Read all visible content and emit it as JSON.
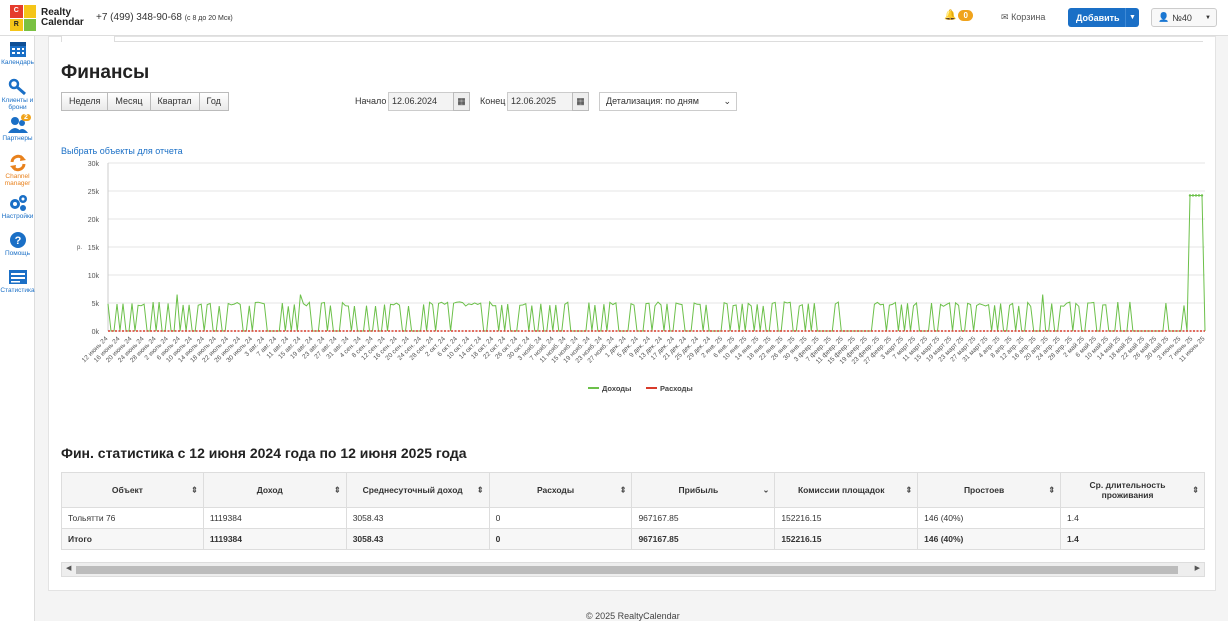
{
  "header": {
    "logo_letters": [
      "C",
      "R",
      "",
      ""
    ],
    "logo_line1": "Realty",
    "logo_line2": "Calendar",
    "phone": "+7 (499) 348-90-68",
    "phone_hours": "(с 8 до 20 Мск)",
    "notif_count": "0",
    "cart_label": "Корзина",
    "add_label": "Добавить",
    "user_label": "№40"
  },
  "sidebar": {
    "items": [
      {
        "label": "Календарь",
        "icon": "calendar-icon"
      },
      {
        "label": "Клиенты и брони",
        "icon": "key-icon"
      },
      {
        "label": "Партнеры",
        "icon": "users-icon",
        "badge": "2"
      },
      {
        "label": "Channel manager",
        "icon": "sync-icon"
      },
      {
        "label": "Настройки",
        "icon": "gears-icon"
      },
      {
        "label": "Помощь",
        "icon": "help-icon"
      },
      {
        "label": "Статистика",
        "icon": "stats-icon"
      }
    ]
  },
  "page": {
    "title": "Финансы",
    "periods": [
      "Неделя",
      "Месяц",
      "Квартал",
      "Год"
    ],
    "start_label": "Начало",
    "start_value": "12.06.2024",
    "end_label": "Конец",
    "end_value": "12.06.2025",
    "detail_select": "Детализация: по дням",
    "objects_link": "Выбрать объекты для отчета"
  },
  "chart_data": {
    "type": "line",
    "ylim": [
      0,
      30000
    ],
    "y_ticks": [
      "0k",
      "5k",
      "10k",
      "15k",
      "20k",
      "25k",
      "30k"
    ],
    "ylabel": "р.",
    "x_ticks": [
      "12 июнь 24",
      "16 июнь 24",
      "20 июнь 24",
      "24 июнь 24",
      "28 июнь 24",
      "2 июль 24",
      "6 июль 24",
      "10 июль 24",
      "14 июль 24",
      "18 июль 24",
      "22 июль 24",
      "26 июль 24",
      "30 июль 24",
      "3 авг. 24",
      "7 авг. 24",
      "11 авг. 24",
      "15 авг. 24",
      "19 авг. 24",
      "23 авг. 24",
      "27 авг. 24",
      "31 авг. 24",
      "4 сен. 24",
      "8 сен. 24",
      "12 сен. 24",
      "16 сен. 24",
      "20 сен. 24",
      "24 сен. 24",
      "28 сен. 24",
      "2 окт. 24",
      "6 окт. 24",
      "10 окт. 24",
      "14 окт. 24",
      "18 окт. 24",
      "22 окт. 24",
      "26 окт. 24",
      "30 окт. 24",
      "3 нояб. 24",
      "7 нояб. 24",
      "11 нояб. 24",
      "15 нояб. 24",
      "19 нояб. 24",
      "23 нояб. 24",
      "27 нояб. 24",
      "1 дек. 24",
      "5 дек. 24",
      "9 дек. 24",
      "13 дек. 24",
      "17 дек. 24",
      "21 дек. 24",
      "25 дек. 24",
      "29 дек. 24",
      "2 янв. 25",
      "6 янв. 25",
      "10 янв. 25",
      "14 янв. 25",
      "18 янв. 25",
      "22 янв. 25",
      "26 янв. 25",
      "30 янв. 25",
      "3 февр. 25",
      "7 февр. 25",
      "11 февр. 25",
      "15 февр. 25",
      "19 февр. 25",
      "23 февр. 25",
      "27 февр. 25",
      "3 март 25",
      "7 март 25",
      "11 март 25",
      "15 март 25",
      "19 март 25",
      "23 март 25",
      "27 март 25",
      "31 март 25",
      "4 апр. 25",
      "8 апр. 25",
      "12 апр. 25",
      "16 апр. 25",
      "20 апр. 25",
      "24 апр. 25",
      "28 апр. 25",
      "2 май 25",
      "6 май 25",
      "10 май 25",
      "14 май 25",
      "18 май 25",
      "22 май 25",
      "26 май 25",
      "30 май 25",
      "3 июнь 25",
      "7 июнь 25",
      "11 июнь 25"
    ],
    "series": [
      {
        "name": "Доходы",
        "color": "#6cc04a"
      },
      {
        "name": "Расходы",
        "color": "#d83b2b",
        "value": 0
      }
    ],
    "income_base": 4800,
    "income_peak": 24200
  },
  "stats": {
    "title": "Фин. статистика с 12 июня 2024 года по 12 июня 2025 года",
    "columns": [
      "Объект",
      "Доход",
      "Среднесуточный доход",
      "Расходы",
      "Прибыль",
      "Комиссии площадок",
      "Простоев",
      "Ср. длительность проживания"
    ],
    "rows": [
      [
        "Тольятти 76",
        "1119384",
        "3058.43",
        "0",
        "967167.85",
        "152216.15",
        "146 (40%)",
        "1.4"
      ],
      [
        "Итого",
        "1119384",
        "3058.43",
        "0",
        "967167.85",
        "152216.15",
        "146 (40%)",
        "1.4"
      ]
    ]
  },
  "footer": "© 2025 RealtyCalendar"
}
